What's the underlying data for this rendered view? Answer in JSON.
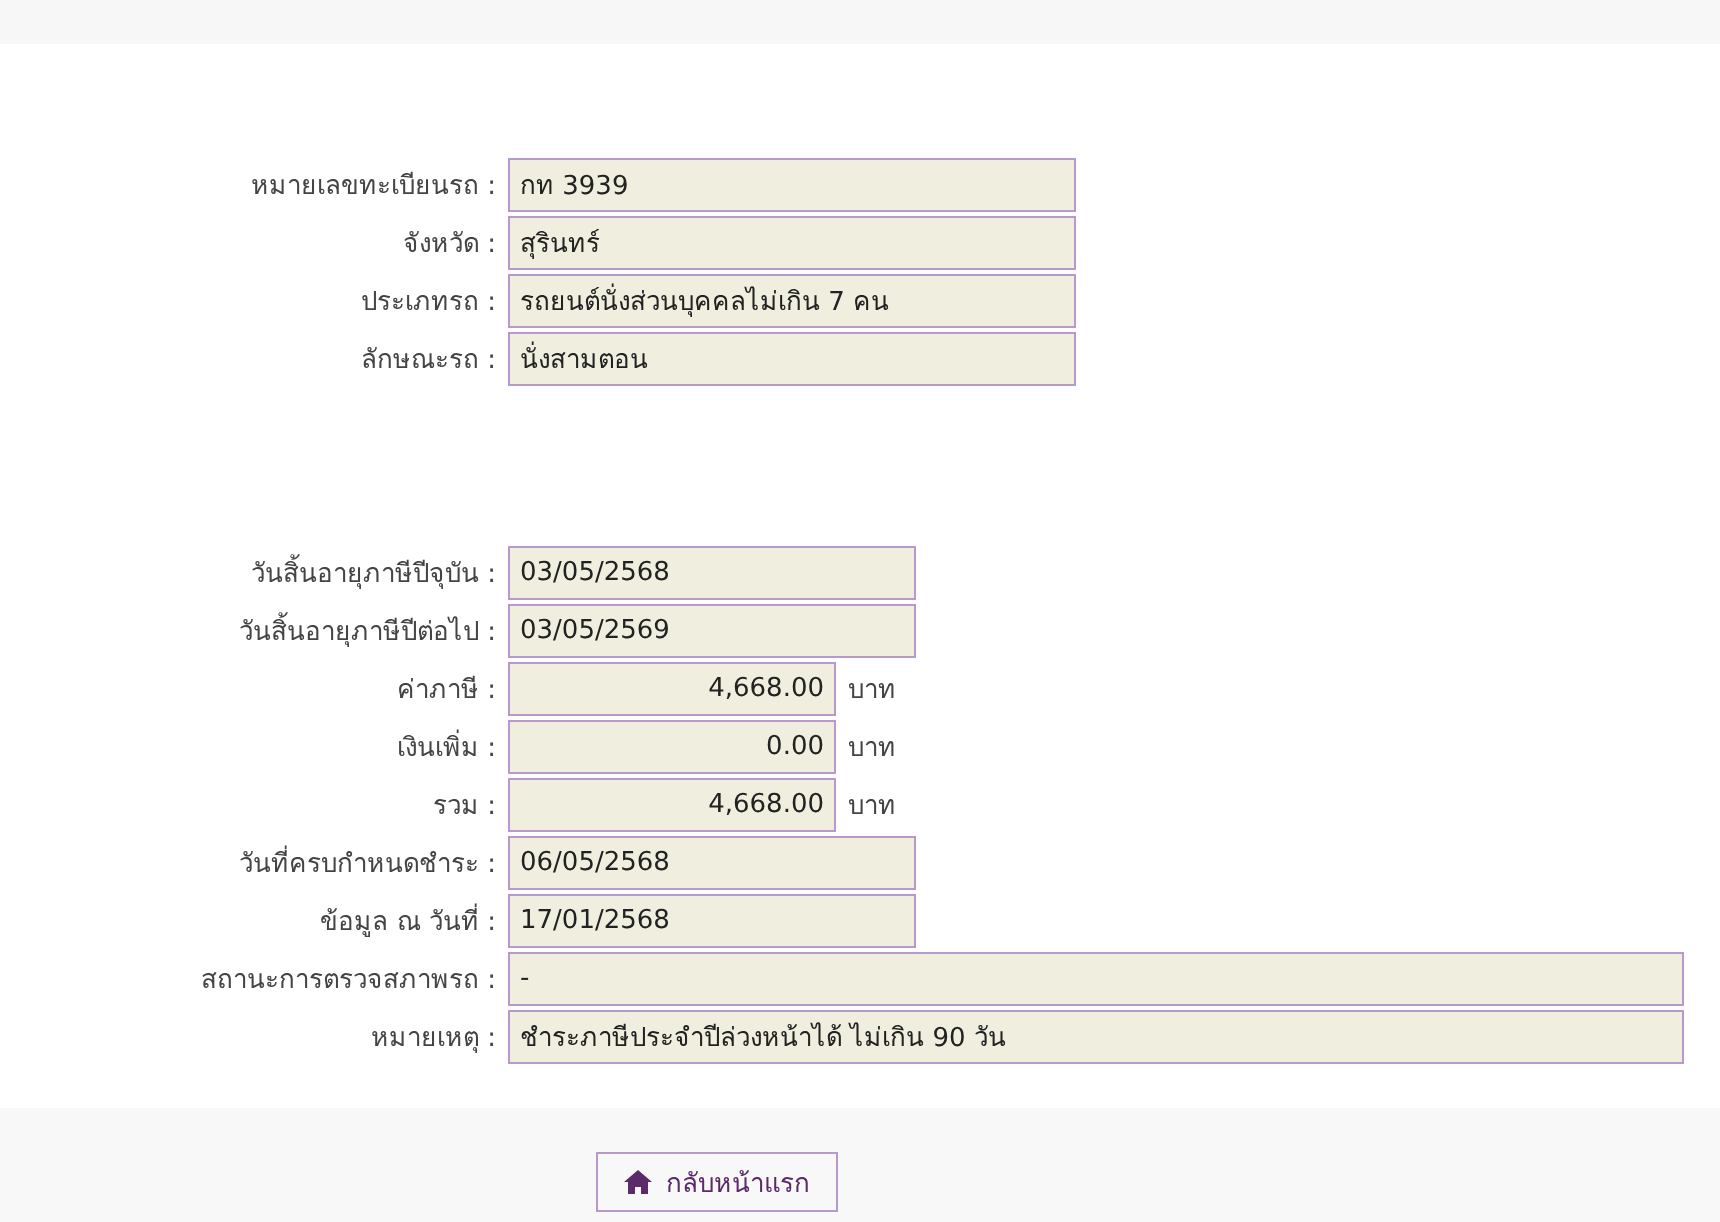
{
  "vehicle_fields": [
    {
      "label": "หมายเลขทะเบียนรถ :",
      "value": "กท 3939",
      "kind": "wide"
    },
    {
      "label": "จังหวัด :",
      "value": "สุรินทร์",
      "kind": "wide"
    },
    {
      "label": "ประเภทรถ :",
      "value": "รถยนต์นั่งส่วนบุคคลไม่เกิน 7 คน",
      "kind": "wide"
    },
    {
      "label": "ลักษณะรถ :",
      "value": "นั่งสามตอน",
      "kind": "wide"
    }
  ],
  "tax_fields": [
    {
      "label": "วันสิ้นอายุภาษีปีจุบัน :",
      "value": "03/05/2568",
      "kind": "date"
    },
    {
      "label": "วันสิ้นอายุภาษีปีต่อไป :",
      "value": "03/05/2569",
      "kind": "date"
    },
    {
      "label": "ค่าภาษี :",
      "value": "4,668.00",
      "kind": "money",
      "unit": "บาท"
    },
    {
      "label": "เงินเพิ่ม :",
      "value": "0.00",
      "kind": "money",
      "unit": "บาท"
    },
    {
      "label": "รวม :",
      "value": "4,668.00",
      "kind": "money",
      "unit": "บาท"
    },
    {
      "label": "วันที่ครบกำหนดชำระ :",
      "value": "06/05/2568",
      "kind": "date"
    },
    {
      "label": "ข้อมูล ณ วันที่ :",
      "value": "17/01/2568",
      "kind": "date"
    },
    {
      "label": "สถานะการตรวจสภาพรถ :",
      "value": "-",
      "kind": "full"
    },
    {
      "label": "หมายเหตุ :",
      "value": "ชำระภาษีประจำปีล่วงหน้าได้ ไม่เกิน 90 วัน",
      "kind": "full"
    }
  ],
  "home_button": {
    "label": "กลับหน้าแรก"
  }
}
